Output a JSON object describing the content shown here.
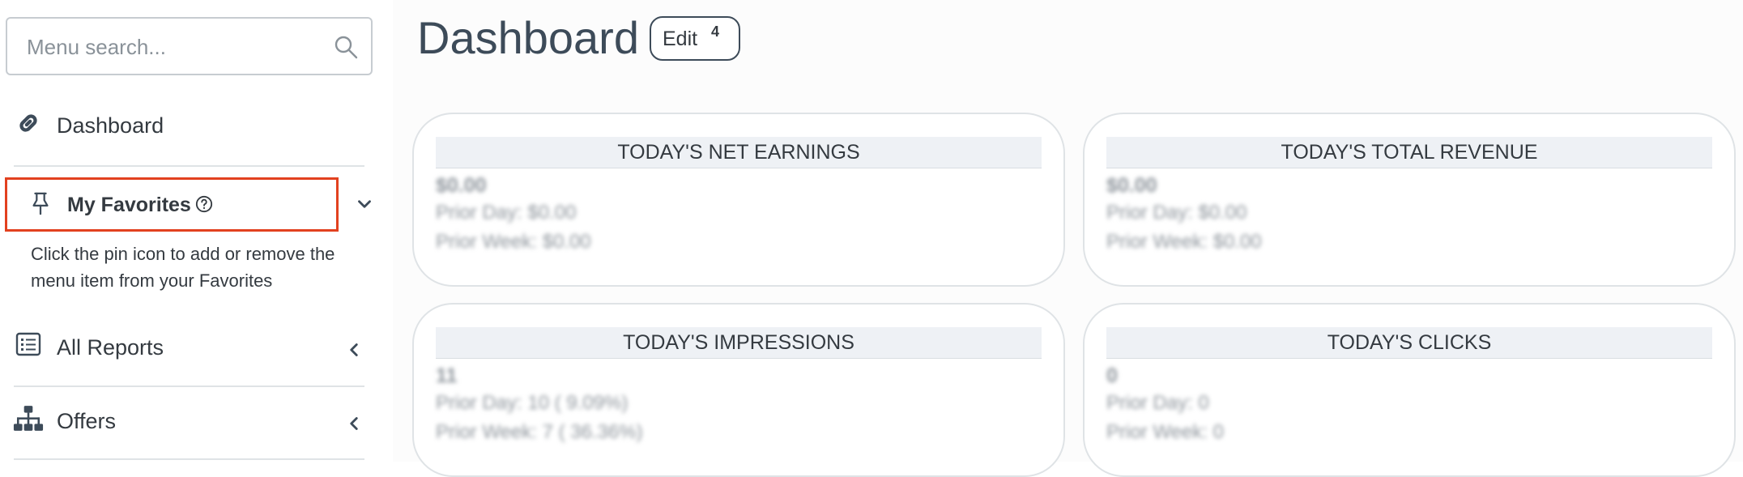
{
  "sidebar": {
    "search": {
      "placeholder": "Menu search...",
      "value": ""
    },
    "items": [
      {
        "label": "Dashboard",
        "icon": "link-icon"
      },
      {
        "label": "My Favorites",
        "icon": "pin-icon",
        "help_icon": "question-circle-icon",
        "hint": "Click the pin icon to add or remove the menu item from your Favorites",
        "expanded": true
      },
      {
        "label": "All Reports",
        "icon": "list-icon",
        "expanded": false
      },
      {
        "label": "Offers",
        "icon": "sitemap-icon",
        "expanded": false
      }
    ],
    "highlight_color": "#e2411f"
  },
  "main": {
    "title": "Dashboard",
    "edit": {
      "label": "Edit",
      "badge": "4"
    },
    "cards": [
      {
        "title": "TODAY'S NET EARNINGS",
        "value": "$0.00",
        "prior_day": "Prior Day: $0.00",
        "prior_week": "Prior Week: $0.00"
      },
      {
        "title": "TODAY'S TOTAL REVENUE",
        "value": "$0.00",
        "prior_day": "Prior Day: $0.00",
        "prior_week": "Prior Week: $0.00"
      },
      {
        "title": "TODAY'S IMPRESSIONS",
        "value": "11",
        "prior_day": "Prior Day: 10 ( 9.09%)",
        "prior_week": "Prior Week: 7 ( 36.36%)"
      },
      {
        "title": "TODAY'S CLICKS",
        "value": "0",
        "prior_day": "Prior Day: 0",
        "prior_week": "Prior Week: 0"
      }
    ]
  }
}
